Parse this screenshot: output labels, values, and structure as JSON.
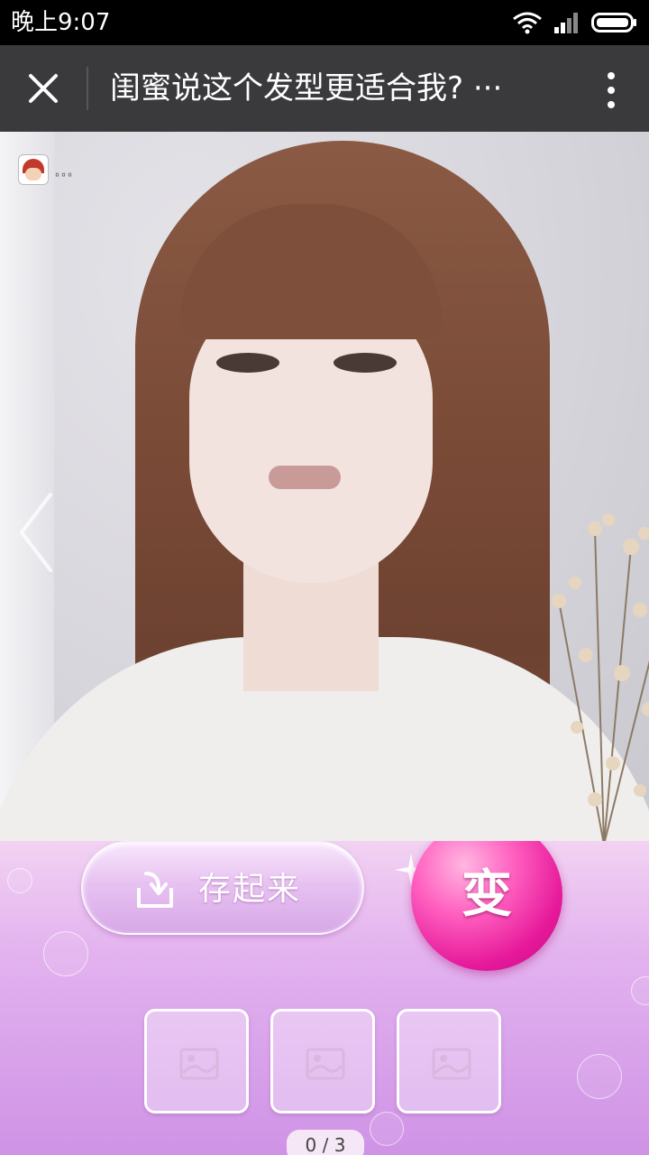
{
  "status_bar": {
    "time": "晚上9:07",
    "icons": [
      "wifi-icon",
      "signal-icon",
      "battery-icon"
    ]
  },
  "nav_bar": {
    "title": "闺蜜说这个发型更适合我?  ···",
    "close_icon": "close-icon",
    "more_icon": "vertical-dots-icon"
  },
  "photo": {
    "watermark_text": "...",
    "prev_icon": "chevron-left-icon"
  },
  "actions": {
    "save_label": "存起来",
    "change_label": "变"
  },
  "thumbnails": [
    {
      "icon": "image-placeholder-icon"
    },
    {
      "icon": "image-placeholder-icon"
    },
    {
      "icon": "image-placeholder-icon"
    }
  ],
  "pager": {
    "text": "0 / 3"
  },
  "colors": {
    "nav_bg": "#3a3a3d",
    "panel_top": "#f2d2f2",
    "panel_bottom": "#cf93e6",
    "change_button": "#e6199a"
  }
}
